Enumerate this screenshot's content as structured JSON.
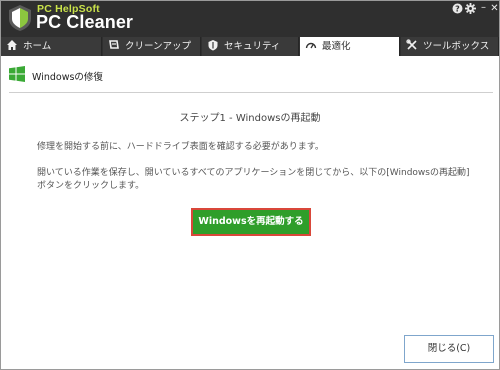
{
  "app": {
    "brand_small": "PC HelpSoft",
    "brand_name": "PC Cleaner"
  },
  "title_controls": {
    "help_icon": "?",
    "settings_icon": "gear",
    "minimize_icon": "–",
    "close_icon": "✕"
  },
  "tabs": [
    {
      "label": "ホーム",
      "icon": "home-icon"
    },
    {
      "label": "クリーンアップ",
      "icon": "broom-icon"
    },
    {
      "label": "セキュリティ",
      "icon": "shield-icon"
    },
    {
      "label": "最適化",
      "icon": "speedometer-icon",
      "active": true
    },
    {
      "label": "ツールボックス",
      "icon": "tools-icon"
    }
  ],
  "section": {
    "title": "Windowsの修復"
  },
  "content": {
    "step_title": "ステップ1 - Windowsの再起動",
    "text1": "修理を開始する前に、ハードドライブ表面を確認する必要があります。",
    "text2": "開いている作業を保存し、開いているすべてのアプリケーションを閉じてから、以下の[Windowsの再起動]ボタンをクリックします。",
    "restart_button": "Windowsを再起動する",
    "close_button": "閉じる(C)"
  },
  "colors": {
    "titlebar": "#2f2f2f",
    "brand_accent": "#c9e24a",
    "restart_button": "#2f9e2a",
    "restart_border": "#d9473a"
  }
}
